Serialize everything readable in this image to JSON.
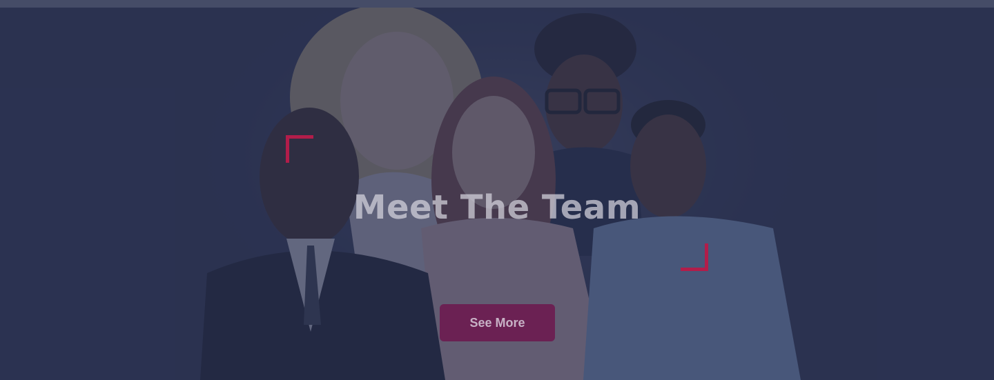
{
  "hero": {
    "title": "Meet The Team",
    "cta_label": "See More"
  },
  "theme": {
    "accent": "#b21d4a",
    "background": "#2f3653",
    "top_bar": "#454c67",
    "button_bg": "#6b2153"
  },
  "image": {
    "subject": "team-group-photo"
  }
}
